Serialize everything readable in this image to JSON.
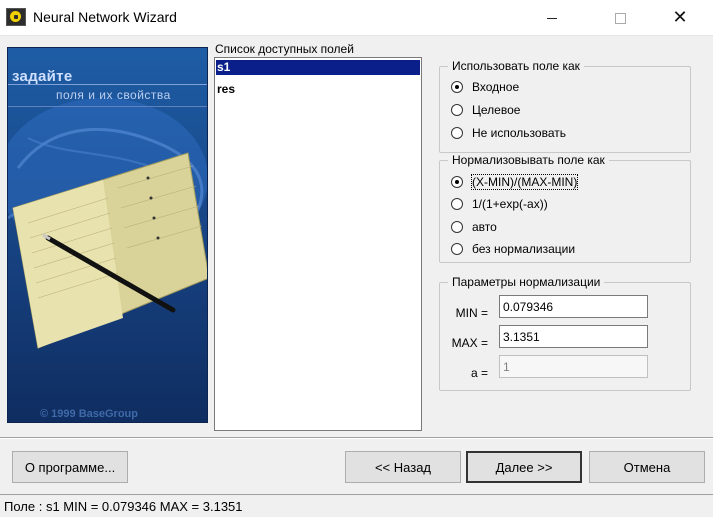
{
  "window": {
    "title": "Neural Network Wizard",
    "minimize_symbol": "",
    "maximize_symbol": "",
    "close_symbol": "✕"
  },
  "banner": {
    "title": "задайте",
    "subtitle": "поля и их свойства",
    "copyright": "© 1999 BaseGroup"
  },
  "fields": {
    "label": "Список доступных полей",
    "items": [
      {
        "label": "s1",
        "selected": true
      },
      {
        "label": "res",
        "selected": false
      }
    ]
  },
  "use_as": {
    "title": "Использовать поле как",
    "options": [
      {
        "label": "Входное",
        "checked": true
      },
      {
        "label": "Целевое",
        "checked": false
      },
      {
        "label": "Не использовать",
        "checked": false
      }
    ]
  },
  "normalize": {
    "title": "Нормализовывать поле как",
    "options": [
      {
        "label": "(X-MIN)/(MAX-MIN)",
        "checked": true
      },
      {
        "label": "1/(1+exp(-ax))",
        "checked": false
      },
      {
        "label": "авто",
        "checked": false
      },
      {
        "label": "без нормализации",
        "checked": false
      }
    ]
  },
  "params": {
    "title": "Параметры нормализации",
    "min_label": "MIN =",
    "min_value": "0.079346",
    "max_label": "MAX =",
    "max_value": "3.1351",
    "a_label": "a =",
    "a_value": "1"
  },
  "buttons": {
    "about": "О программе...",
    "back": "<< Назад",
    "next": "Далее >>",
    "cancel": "Отмена"
  },
  "status": {
    "text": "Поле : s1  MIN = 0.079346 MAX = 3.1351"
  }
}
